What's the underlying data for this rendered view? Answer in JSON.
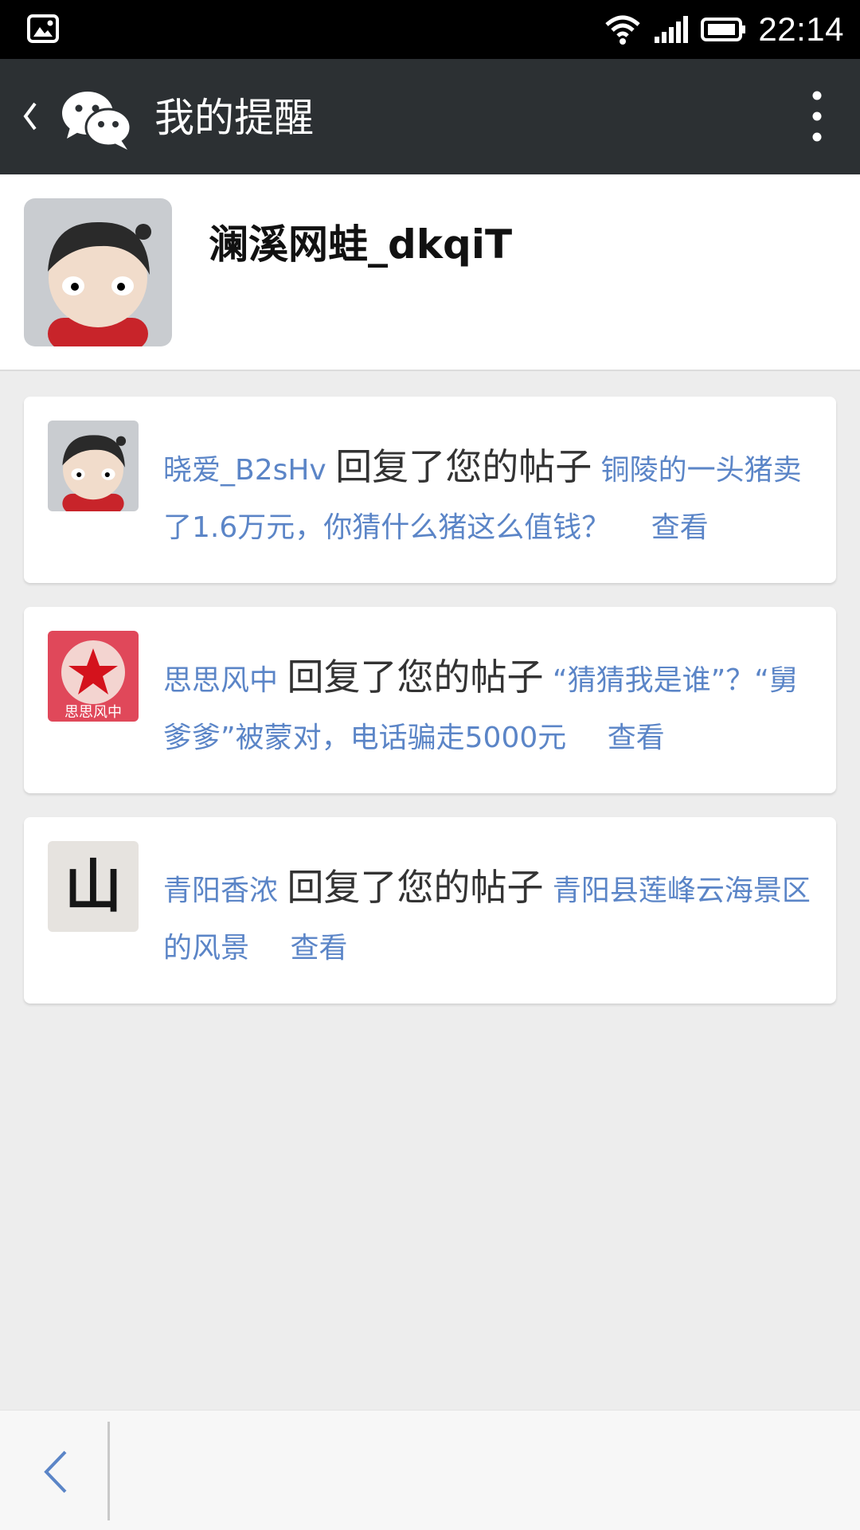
{
  "status_bar": {
    "time": "22:14",
    "icons": [
      "image-notification-icon",
      "wifi-icon",
      "signal-icon",
      "battery-icon"
    ]
  },
  "title_bar": {
    "title": "我的提醒",
    "icons": [
      "back-chevron-icon",
      "wechat-logo-icon",
      "more-vertical-icon"
    ]
  },
  "profile": {
    "name": "澜溪网蛙_dkqiT"
  },
  "notifications": [
    {
      "user": "晓爱_B2sHv",
      "action": "回复了您的帖子",
      "post": "铜陵的一头猪卖了1.6万元，你猜什么猪这么值钱？",
      "view_label": "查看"
    },
    {
      "user": "思思风中",
      "action": "回复了您的帖子",
      "post": "“猜猜我是谁”？“舅爹爹”被蒙对，电话骗走5000元",
      "view_label": "查看"
    },
    {
      "user": "青阳香浓",
      "action": "回复了您的帖子",
      "post": "青阳县莲峰云海景区的风景",
      "view_label": "查看"
    }
  ],
  "avatar_glyphs": {
    "sisi": "思思风中",
    "qingyang": "山"
  },
  "colors": {
    "link": "#5b85c7",
    "titlebar": "#2c3033",
    "background": "#ededed"
  }
}
